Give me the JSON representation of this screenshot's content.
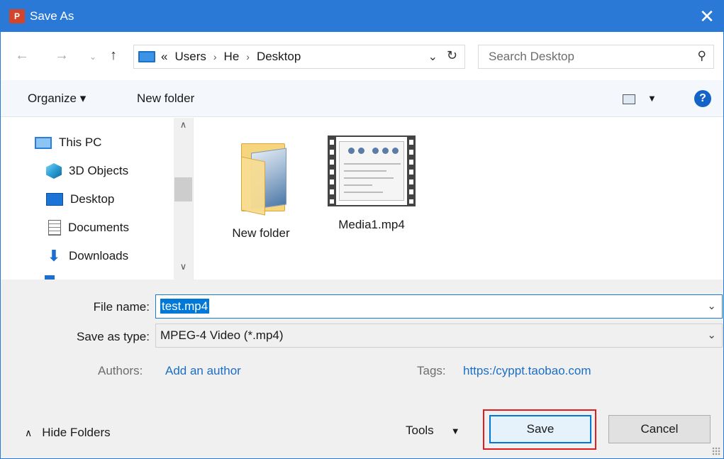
{
  "window": {
    "app_badge": "P",
    "title": "Save As",
    "close_glyph": "✕"
  },
  "address": {
    "overflow": "«",
    "crumbs": [
      "Users",
      "He",
      "Desktop"
    ],
    "separator": "›",
    "search_placeholder": "Search Desktop"
  },
  "toolbar": {
    "organize": "Organize ▾",
    "new_folder": "New folder",
    "help": "?"
  },
  "navpane": {
    "items": [
      {
        "label": "This PC",
        "icon": "computer-icon"
      },
      {
        "label": "3D Objects",
        "icon": "3d-objects-icon"
      },
      {
        "label": "Desktop",
        "icon": "desktop-icon"
      },
      {
        "label": "Documents",
        "icon": "documents-icon"
      },
      {
        "label": "Downloads",
        "icon": "downloads-icon"
      }
    ]
  },
  "files": [
    {
      "name": "New folder",
      "icon": "folder-icon"
    },
    {
      "name": "Media1.mp4",
      "icon": "video-file-icon"
    }
  ],
  "form": {
    "filename_label": "File name:",
    "filename_value": "test.mp4",
    "type_label": "Save as type:",
    "type_value": "MPEG-4 Video (*.mp4)",
    "authors_label": "Authors:",
    "authors_value": "Add an author",
    "tags_label": "Tags:",
    "tags_value": "https:/cyppt.taobao.com"
  },
  "footer": {
    "hide_folders": "Hide Folders",
    "tools": "Tools",
    "save": "Save",
    "cancel": "Cancel"
  },
  "colors": {
    "titlebar": "#2b79d6",
    "highlight": "#e21c1c",
    "selection": "#0078d7"
  }
}
